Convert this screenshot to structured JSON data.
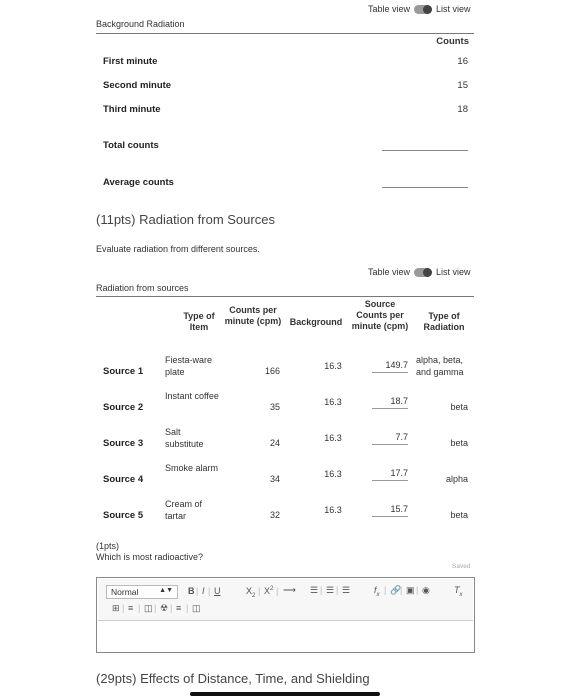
{
  "toggle": {
    "table_view": "Table view",
    "list_view": "List view"
  },
  "background": {
    "title": "Background Radiation",
    "counts_header": "Counts",
    "rows": [
      {
        "label": "First minute",
        "value": "16"
      },
      {
        "label": "Second minute",
        "value": "15"
      },
      {
        "label": "Third minute",
        "value": "18"
      }
    ],
    "total_label": "Total counts",
    "average_label": "Average counts"
  },
  "sources_section": {
    "heading": "(11pts) Radiation from Sources",
    "description": "Evaluate radiation from different sources.",
    "table_title": "Radiation from sources",
    "headers": {
      "type_of_item": "Type of Item",
      "counts_per_minute": "Counts per minute (cpm)",
      "background": "Background",
      "source_counts": "Source Counts per minute (cpm)",
      "type_of_radiation": "Type of Radiation"
    },
    "rows": [
      {
        "label": "Source 1",
        "item": "Fiesta-ware plate",
        "cpm": "166",
        "bg": "16.3",
        "source_cpm": "149.7",
        "type": "alpha, beta, and gamma"
      },
      {
        "label": "Source 2",
        "item": "Instant coffee",
        "cpm": "35",
        "bg": "16.3",
        "source_cpm": "18.7",
        "type": "beta"
      },
      {
        "label": "Source 3",
        "item": "Salt substitute",
        "cpm": "24",
        "bg": "16.3",
        "source_cpm": "7.7",
        "type": "beta"
      },
      {
        "label": "Source 4",
        "item": "Smoke alarm",
        "cpm": "34",
        "bg": "16.3",
        "source_cpm": "17.7",
        "type": "alpha"
      },
      {
        "label": "Source 5",
        "item": "Cream of tartar",
        "cpm": "32",
        "bg": "16.3",
        "source_cpm": "15.7",
        "type": "beta"
      }
    ]
  },
  "question": {
    "points": "(1pts)",
    "text": "Which is most radioactive?",
    "saved": "Saved"
  },
  "editor": {
    "format_value": "Normal"
  },
  "next_section": {
    "heading": "(29pts) Effects of Distance, Time, and Shielding"
  }
}
